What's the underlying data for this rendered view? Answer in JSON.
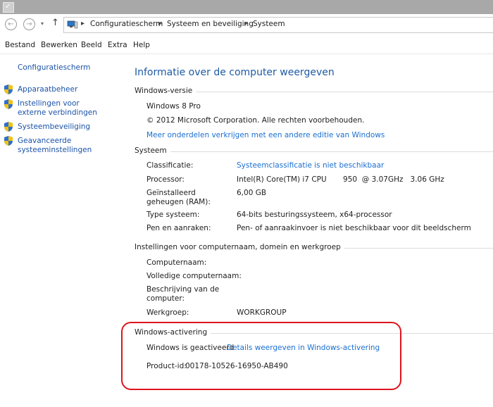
{
  "address": {
    "crumbs": [
      "Configuratiescherm",
      "Systeem en beveiliging",
      "Systeem"
    ]
  },
  "menu": [
    "Bestand",
    "Bewerken",
    "Beeld",
    "Extra",
    "Help"
  ],
  "sidebar": {
    "home": "Configuratiescherm",
    "items": [
      {
        "label": "Apparaatbeheer"
      },
      {
        "label": "Instellingen voor externe verbindingen"
      },
      {
        "label": "Systeembeveiliging"
      },
      {
        "label": "Geavanceerde systeeminstellingen"
      }
    ]
  },
  "main": {
    "title": "Informatie over de computer weergeven",
    "windows_edition": {
      "heading": "Windows-versie",
      "edition": "Windows 8 Pro",
      "copyright": "© 2012 Microsoft Corporation. Alle rechten voorbehouden.",
      "more_link": "Meer onderdelen verkrijgen met een andere editie van Windows"
    },
    "system": {
      "heading": "Systeem",
      "rows": [
        {
          "label": "Classificatie:",
          "value": "Systeemclassificatie is niet beschikbaar"
        },
        {
          "label": "Processor:",
          "value": "Intel(R) Core(TM) i7 CPU       950  @ 3.07GHz   3.06 GHz"
        },
        {
          "label": "Geïnstalleerd geheugen (RAM):",
          "value": "6,00 GB"
        },
        {
          "label": "Type systeem:",
          "value": "64-bits besturingssysteem, x64-processor"
        },
        {
          "label": "Pen en aanraken:",
          "value": "Pen- of aanraakinvoer is niet beschikbaar voor dit beeldscherm"
        }
      ]
    },
    "computer_name": {
      "heading": "Instellingen voor computernaam, domein en werkgroep",
      "rows": [
        {
          "label": "Computernaam:",
          "value": ""
        },
        {
          "label": "Volledige computernaam:",
          "value": ""
        },
        {
          "label": "Beschrijving van de computer:",
          "value": ""
        },
        {
          "label": "Werkgroep:",
          "value": "WORKGROUP"
        }
      ]
    },
    "activation": {
      "heading": "Windows-activering",
      "status": "Windows is geactiveerd",
      "details_link": "Details weergeven in Windows-activering",
      "product_id_label": "Product-id:",
      "product_id": "00178-10526-16950-AB490"
    }
  },
  "colors": {
    "link": "#1a6fd0",
    "title": "#1e5aa3",
    "highlight": "#e0141e"
  },
  "icons": [
    "back-arrow-icon",
    "forward-arrow-icon",
    "up-arrow-icon",
    "computer-icon",
    "shield-icon"
  ]
}
